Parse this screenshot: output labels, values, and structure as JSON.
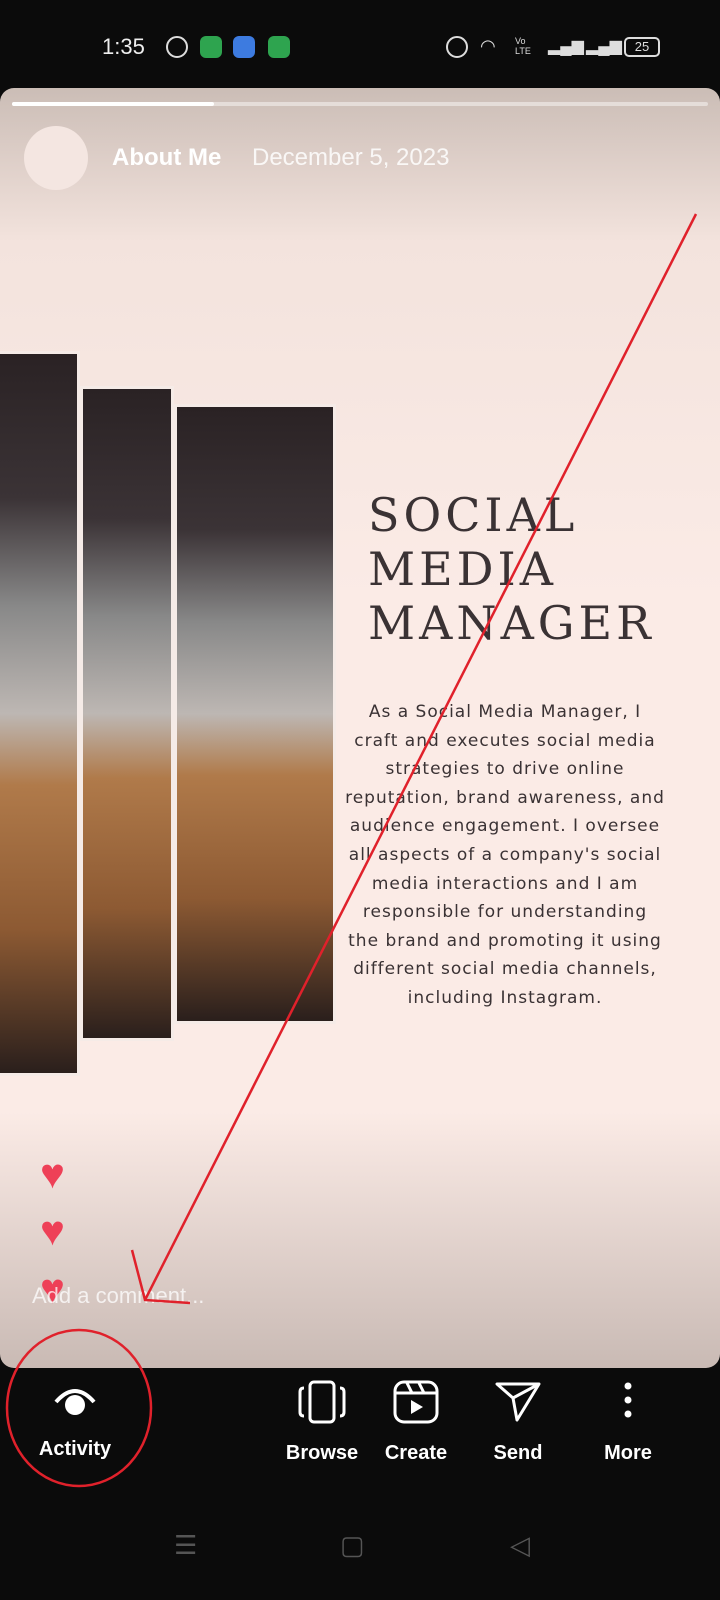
{
  "status_bar": {
    "time": "1:35",
    "battery": "25",
    "icons": [
      "facebook-icon",
      "green-app-icon",
      "blue-app-icon",
      "shield-app-icon",
      "alarm-icon",
      "wifi-icon",
      "volte-icon",
      "signal-icon",
      "signal-icon",
      "battery-icon"
    ]
  },
  "story": {
    "progress": 0.29,
    "username": "About Me",
    "date": "December 5, 2023",
    "title_lines": [
      "SOCIAL",
      "MEDIA",
      "MANAGER"
    ],
    "body": "As a Social Media Manager, I craft and executes social media strategies to drive online reputation, brand awareness, and audience engagement. I oversee all aspects of a company's social media interactions and I am responsible for understanding the brand and promoting it using different social media channels, including Instagram.",
    "comment_placeholder": "Add a comment..."
  },
  "nav": {
    "activity": "Activity",
    "browse": "Browse",
    "create": "Create",
    "send": "Send",
    "more": "More"
  },
  "colors": {
    "heart": "#ee4057",
    "annotation": "#e0212b"
  }
}
